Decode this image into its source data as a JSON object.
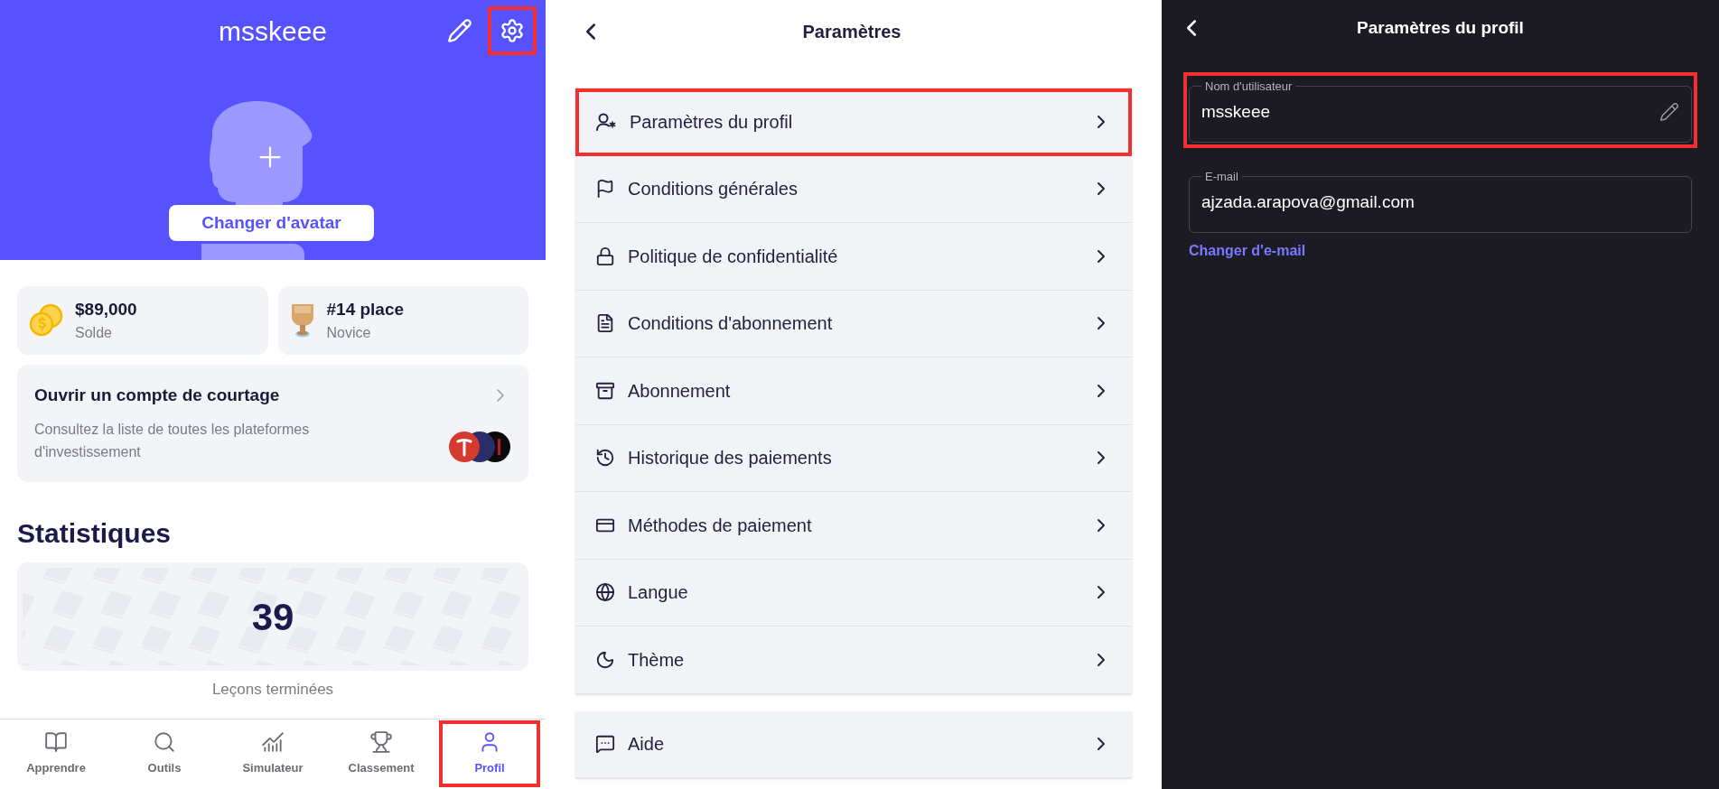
{
  "profile": {
    "username": "msskeee",
    "header_actions": [
      {
        "kind": "pencil",
        "highlighted": false
      },
      {
        "kind": "gear",
        "highlighted": true
      }
    ],
    "change_avatar": "Changer d'avatar",
    "stat_cards": [
      {
        "kind": "coins",
        "value": "$89,000",
        "label": "Solde"
      },
      {
        "kind": "cup",
        "value": "#14 place",
        "label": "Novice"
      }
    ],
    "broker": {
      "title": "Ouvrir un compte de courtage",
      "description": "Consultez la liste de toutes les plateformes d'investissement"
    },
    "statistics": {
      "heading": "Statistiques",
      "value": "39",
      "caption": "Leçons terminées"
    },
    "nav": [
      {
        "kind": "book",
        "label": "Apprendre",
        "selected": false,
        "highlighted": false
      },
      {
        "kind": "search",
        "label": "Outils",
        "selected": false,
        "highlighted": false
      },
      {
        "kind": "chart",
        "label": "Simulateur",
        "selected": false,
        "highlighted": false
      },
      {
        "kind": "trophy",
        "label": "Classement",
        "selected": false,
        "highlighted": false
      },
      {
        "kind": "user",
        "label": "Profil",
        "selected": true,
        "highlighted": true
      }
    ]
  },
  "settings": {
    "title": "Paramètres",
    "items": [
      {
        "kind": "user-star",
        "label": "Paramètres du profil",
        "highlighted": true
      },
      {
        "kind": "flag",
        "label": "Conditions générales",
        "highlighted": false
      },
      {
        "kind": "lock",
        "label": "Politique de confidentialité",
        "highlighted": false
      },
      {
        "kind": "document",
        "label": "Conditions d'abonnement",
        "highlighted": false
      },
      {
        "kind": "archive",
        "label": "Abonnement",
        "highlighted": false
      },
      {
        "kind": "history",
        "label": "Historique des paiements",
        "highlighted": false
      },
      {
        "kind": "card",
        "label": "Méthodes de paiement",
        "highlighted": false
      },
      {
        "kind": "globe",
        "label": "Langue",
        "highlighted": false
      },
      {
        "kind": "moon",
        "label": "Thème",
        "highlighted": false
      }
    ],
    "help": [
      {
        "kind": "chat",
        "label": "Aide",
        "highlighted": false
      }
    ]
  },
  "profile_settings": {
    "title": "Paramètres du profil",
    "fields": [
      {
        "label": "Nom d'utilisateur",
        "value": "msskeee",
        "editable": true,
        "highlighted": true
      },
      {
        "label": "E-mail",
        "value": "ajzada.arapova@gmail.com",
        "editable": false,
        "highlighted": false
      }
    ],
    "change_email": "Changer d'e-mail"
  }
}
